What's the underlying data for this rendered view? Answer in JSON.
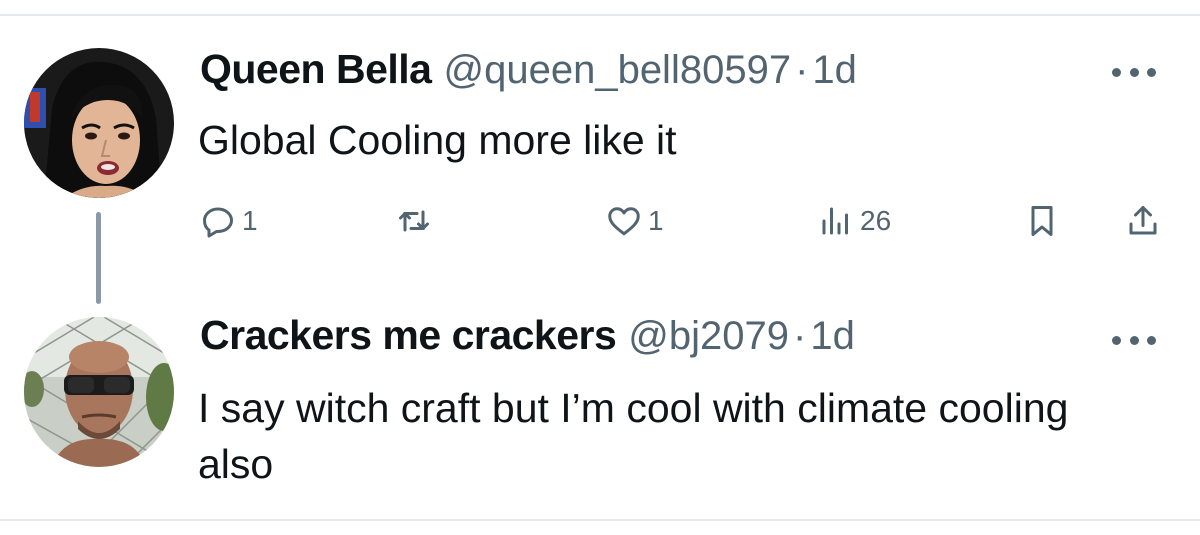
{
  "tweets": [
    {
      "display_name": "Queen Bella",
      "handle": "@queen_bell80597",
      "separator": "·",
      "time": "1d",
      "text": "Global Cooling more like it",
      "avatar_icon": "woman-portrait-avatar"
    },
    {
      "display_name": "Crackers me crackers",
      "handle": "@bj2079",
      "separator": "·",
      "time": "1d",
      "text": "I say witch craft but I’m cool with climate cooling also",
      "avatar_icon": "man-sunglasses-avatar"
    }
  ],
  "actions": {
    "reply_count": "1",
    "retweet_count": "",
    "like_count": "1",
    "views_count": "26"
  },
  "colors": {
    "text_primary": "#0f1419",
    "text_secondary": "#536471",
    "divider": "#e6e9eb",
    "thread_line": "#8b98a5"
  }
}
